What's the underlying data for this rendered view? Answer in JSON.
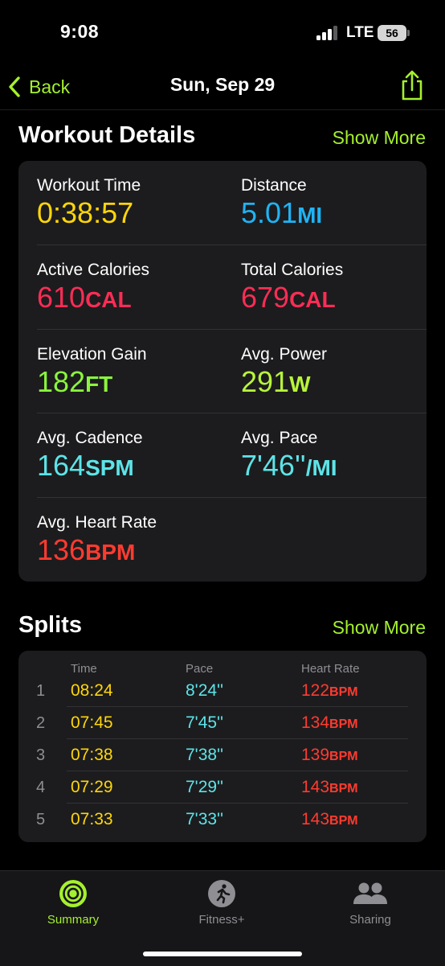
{
  "status": {
    "time": "9:08",
    "network": "LTE",
    "battery": "56"
  },
  "nav": {
    "back_label": "Back",
    "title": "Sun, Sep 29"
  },
  "details": {
    "title": "Workout Details",
    "show_more": "Show More",
    "metrics": [
      {
        "label": "Workout Time",
        "value": "0:38:57",
        "unit": "",
        "color": "#ffd60a"
      },
      {
        "label": "Distance",
        "value": "5.01",
        "unit": "MI",
        "color": "#1fb4f5"
      },
      {
        "label": "Active Calories",
        "value": "610",
        "unit": "CAL",
        "color": "#fa2d55"
      },
      {
        "label": "Total Calories",
        "value": "679",
        "unit": "CAL",
        "color": "#fa2d55"
      },
      {
        "label": "Elevation Gain",
        "value": "182",
        "unit": "FT",
        "color": "#8af53d"
      },
      {
        "label": "Avg. Power",
        "value": "291",
        "unit": "W",
        "color": "#b8f53a"
      },
      {
        "label": "Avg. Cadence",
        "value": "164",
        "unit": "SPM",
        "color": "#5de4e8"
      },
      {
        "label": "Avg. Pace",
        "value": "7'46''",
        "unit": "/MI",
        "color": "#5de4e8"
      },
      {
        "label": "Avg. Heart Rate",
        "value": "136",
        "unit": "BPM",
        "color": "#ff3b30"
      }
    ]
  },
  "splits": {
    "title": "Splits",
    "show_more": "Show More",
    "headers": {
      "time": "Time",
      "pace": "Pace",
      "heart_rate": "Heart Rate"
    },
    "rows": [
      {
        "num": "1",
        "time": "08:24",
        "pace": "8'24''",
        "hr": "122",
        "hr_unit": "BPM"
      },
      {
        "num": "2",
        "time": "07:45",
        "pace": "7'45''",
        "hr": "134",
        "hr_unit": "BPM"
      },
      {
        "num": "3",
        "time": "07:38",
        "pace": "7'38''",
        "hr": "139",
        "hr_unit": "BPM"
      },
      {
        "num": "4",
        "time": "07:29",
        "pace": "7'29''",
        "hr": "143",
        "hr_unit": "BPM"
      },
      {
        "num": "5",
        "time": "07:33",
        "pace": "7'33''",
        "hr": "143",
        "hr_unit": "BPM"
      }
    ]
  },
  "tabs": [
    {
      "label": "Summary",
      "icon": "activity-rings-icon",
      "active": true
    },
    {
      "label": "Fitness+",
      "icon": "runner-icon",
      "active": false
    },
    {
      "label": "Sharing",
      "icon": "people-icon",
      "active": false
    }
  ],
  "colors": {
    "accent": "#a5f02e",
    "inactive_tab": "#8e8e93"
  }
}
